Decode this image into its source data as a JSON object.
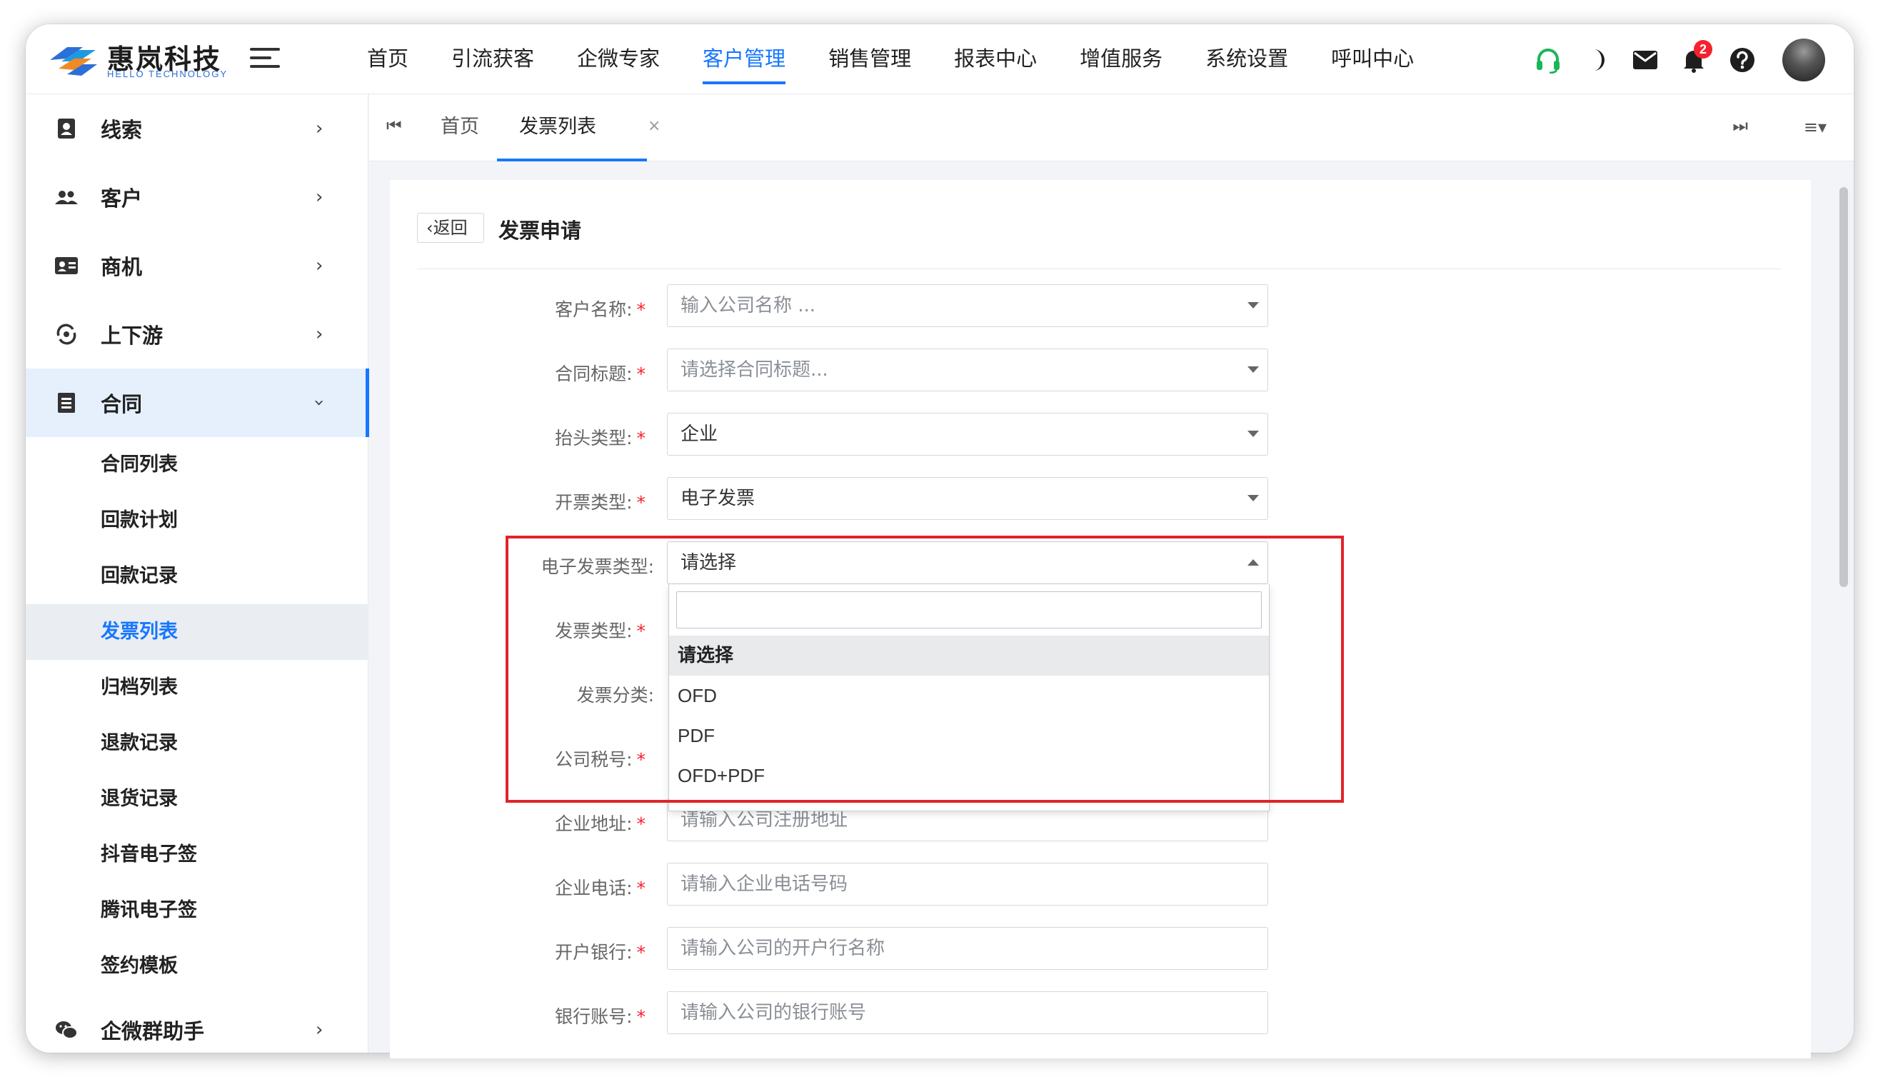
{
  "app": {
    "logo_text": "惠岚科技",
    "logo_sub": "HELLO TECHNOLOGY",
    "brand_color": "#1677ff"
  },
  "topnav": [
    {
      "label": "首页",
      "active": false
    },
    {
      "label": "引流获客",
      "active": false
    },
    {
      "label": "企微专家",
      "active": false
    },
    {
      "label": "客户管理",
      "active": true
    },
    {
      "label": "销售管理",
      "active": false
    },
    {
      "label": "报表中心",
      "active": false
    },
    {
      "label": "增值服务",
      "active": false
    },
    {
      "label": "系统设置",
      "active": false
    },
    {
      "label": "呼叫中心",
      "active": false
    }
  ],
  "top_icons": {
    "headset": "headset-icon",
    "theme": "moon-icon",
    "mail": "mail-icon",
    "bell": "bell-icon",
    "bell_badge": "2",
    "help": "help-icon"
  },
  "sidebar": {
    "items": [
      {
        "label": "线索",
        "icon": "contact-icon"
      },
      {
        "label": "客户",
        "icon": "users-icon"
      },
      {
        "label": "商机",
        "icon": "id-card-icon"
      },
      {
        "label": "上下游",
        "icon": "sync-icon"
      },
      {
        "label": "合同",
        "icon": "document-icon",
        "open": true
      },
      {
        "label": "企微群助手",
        "icon": "wechat-icon"
      }
    ],
    "sub_items": [
      {
        "label": "合同列表"
      },
      {
        "label": "回款计划"
      },
      {
        "label": "回款记录"
      },
      {
        "label": "发票列表",
        "active": true
      },
      {
        "label": "归档列表"
      },
      {
        "label": "退款记录"
      },
      {
        "label": "退货记录"
      },
      {
        "label": "抖音电子签"
      },
      {
        "label": "腾讯电子签"
      },
      {
        "label": "签约模板"
      }
    ]
  },
  "tabs": {
    "items": [
      {
        "label": "首页"
      },
      {
        "label": "发票列表",
        "active": true
      }
    ],
    "close": "×"
  },
  "form": {
    "back_label": "返回",
    "title": "发票申请",
    "fields": [
      {
        "label": "客户名称:",
        "required": true,
        "value": "输入公司名称 ...",
        "placeholder": true,
        "type": "select"
      },
      {
        "label": "合同标题:",
        "required": true,
        "value": "请选择合同标题...",
        "placeholder": true,
        "type": "select"
      },
      {
        "label": "抬头类型:",
        "required": true,
        "value": "企业",
        "type": "select"
      },
      {
        "label": "开票类型:",
        "required": true,
        "value": "电子发票",
        "type": "select"
      },
      {
        "label": "电子发票类型:",
        "required": false,
        "value": "请选择",
        "type": "select-open"
      },
      {
        "label": "发票类型:",
        "required": true
      },
      {
        "label": "发票分类:",
        "required": false
      },
      {
        "label": "公司税号:",
        "required": true
      },
      {
        "label": "企业地址:",
        "required": true,
        "value": "请输入公司注册地址",
        "placeholder": true,
        "type": "input"
      },
      {
        "label": "企业电话:",
        "required": true,
        "value": "请输入企业电话号码",
        "placeholder": true,
        "type": "input"
      },
      {
        "label": "开户银行:",
        "required": true,
        "value": "请输入公司的开户行名称",
        "placeholder": true,
        "type": "input"
      },
      {
        "label": "银行账号:",
        "required": true,
        "value": "请输入公司的银行账号",
        "placeholder": true,
        "type": "input"
      }
    ],
    "dropdown_options": [
      "请选择",
      "OFD",
      "PDF",
      "OFD+PDF"
    ],
    "dropdown_selected": "请选择"
  },
  "annotation_color": "#e0242b"
}
